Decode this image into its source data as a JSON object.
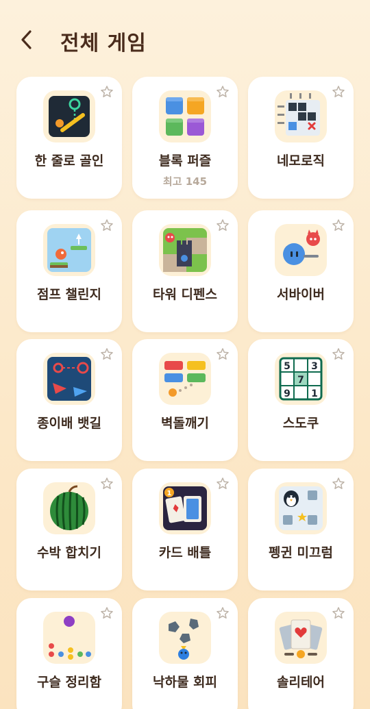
{
  "header": {
    "title": "전체 게임"
  },
  "games": [
    {
      "name": "한 줄로 골인",
      "icon": "one-line-goal-icon"
    },
    {
      "name": "블록 퍼즐",
      "best": "최고 145",
      "icon": "block-puzzle-icon"
    },
    {
      "name": "네모로직",
      "icon": "nemologic-icon"
    },
    {
      "name": "점프 챌린지",
      "icon": "jump-challenge-icon"
    },
    {
      "name": "타워 디펜스",
      "icon": "tower-defense-icon"
    },
    {
      "name": "서바이버",
      "icon": "survivor-icon"
    },
    {
      "name": "종이배 뱃길",
      "icon": "paper-boat-icon"
    },
    {
      "name": "벽돌깨기",
      "icon": "brick-breaker-icon"
    },
    {
      "name": "스도쿠",
      "icon": "sudoku-icon",
      "cells": [
        "5",
        "3",
        "7",
        "9",
        "1"
      ]
    },
    {
      "name": "수박 합치기",
      "icon": "watermelon-icon"
    },
    {
      "name": "카드 배틀",
      "icon": "card-battle-icon",
      "badge": "1"
    },
    {
      "name": "펭귄 미끄럼",
      "icon": "penguin-slide-icon"
    },
    {
      "name": "구슬 정리함",
      "icon": "marble-sort-icon"
    },
    {
      "name": "낙하물 회피",
      "icon": "falling-dodge-icon"
    },
    {
      "name": "솔리테어",
      "icon": "solitaire-icon"
    }
  ],
  "colors": {
    "title": "#4a2c1c",
    "card": "#ffffff",
    "iconBg": "#fdf0d6",
    "star": "#bdb3a8"
  }
}
